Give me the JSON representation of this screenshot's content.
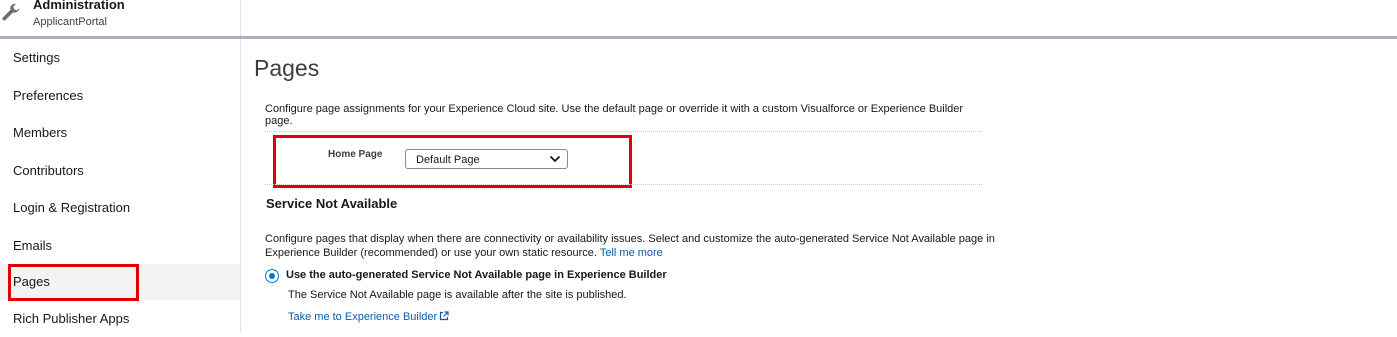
{
  "header": {
    "title": "Administration",
    "subtitle": "ApplicantPortal",
    "icon": "wrench-icon"
  },
  "sidebar": {
    "items": [
      {
        "label": "Settings"
      },
      {
        "label": "Preferences"
      },
      {
        "label": "Members"
      },
      {
        "label": "Contributors"
      },
      {
        "label": "Login & Registration"
      },
      {
        "label": "Emails"
      },
      {
        "label": "Pages",
        "active": true
      },
      {
        "label": "Rich Publisher Apps"
      }
    ]
  },
  "main": {
    "title": "Pages",
    "intro": "Configure page assignments for your Experience Cloud site. Use the default page or override it with a custom Visualforce or Experience Builder page.",
    "home_page": {
      "label": "Home Page",
      "value": "Default Page"
    },
    "service": {
      "title": "Service Not Available",
      "description": "Configure pages that display when there are connectivity or availability issues. Select and customize the auto-generated Service Not Available page in Experience Builder (recommended) or use your own static resource.",
      "tell_me_more": "Tell me more",
      "radio_label": "Use the auto-generated Service Not Available page in Experience Builder",
      "radio_selected": true,
      "note": "The Service Not Available page is available after the site is published.",
      "builder_link": "Take me to Experience Builder"
    }
  },
  "colors": {
    "highlight": "#e00000",
    "link": "#0b5cab",
    "radio": "#0176d3",
    "header_bar": "#a6b1bc"
  }
}
